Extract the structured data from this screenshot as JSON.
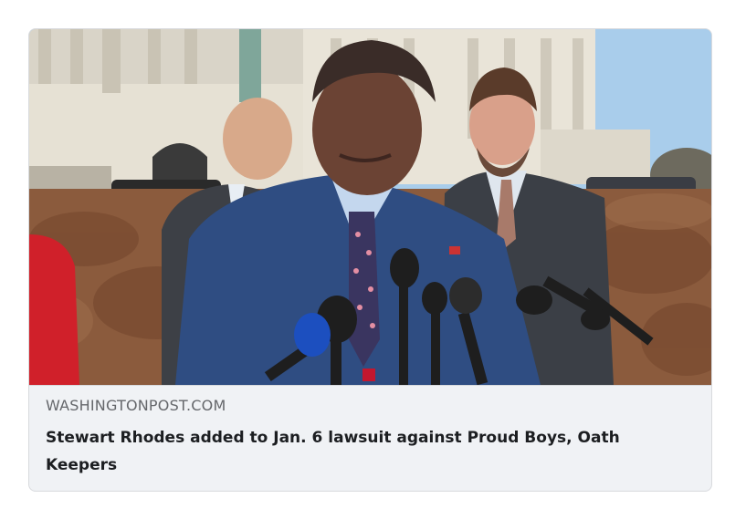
{
  "link_preview": {
    "domain": "WASHINGTONPOST.COM",
    "headline": "Stewart Rhodes added to Jan. 6 lawsuit against Proud Boys, Oath Keepers",
    "image_subject": "press-conference-photo"
  },
  "colors": {
    "card_background": "#f0f2f5",
    "card_border": "#d8dadd",
    "domain_text": "#65676b",
    "headline_text": "#1c1e21",
    "sky": "#9ec7e8",
    "hedge": "#8a5a3c",
    "suit_blue": "#2e4a7e",
    "suit_gray": "#3b3f46"
  }
}
